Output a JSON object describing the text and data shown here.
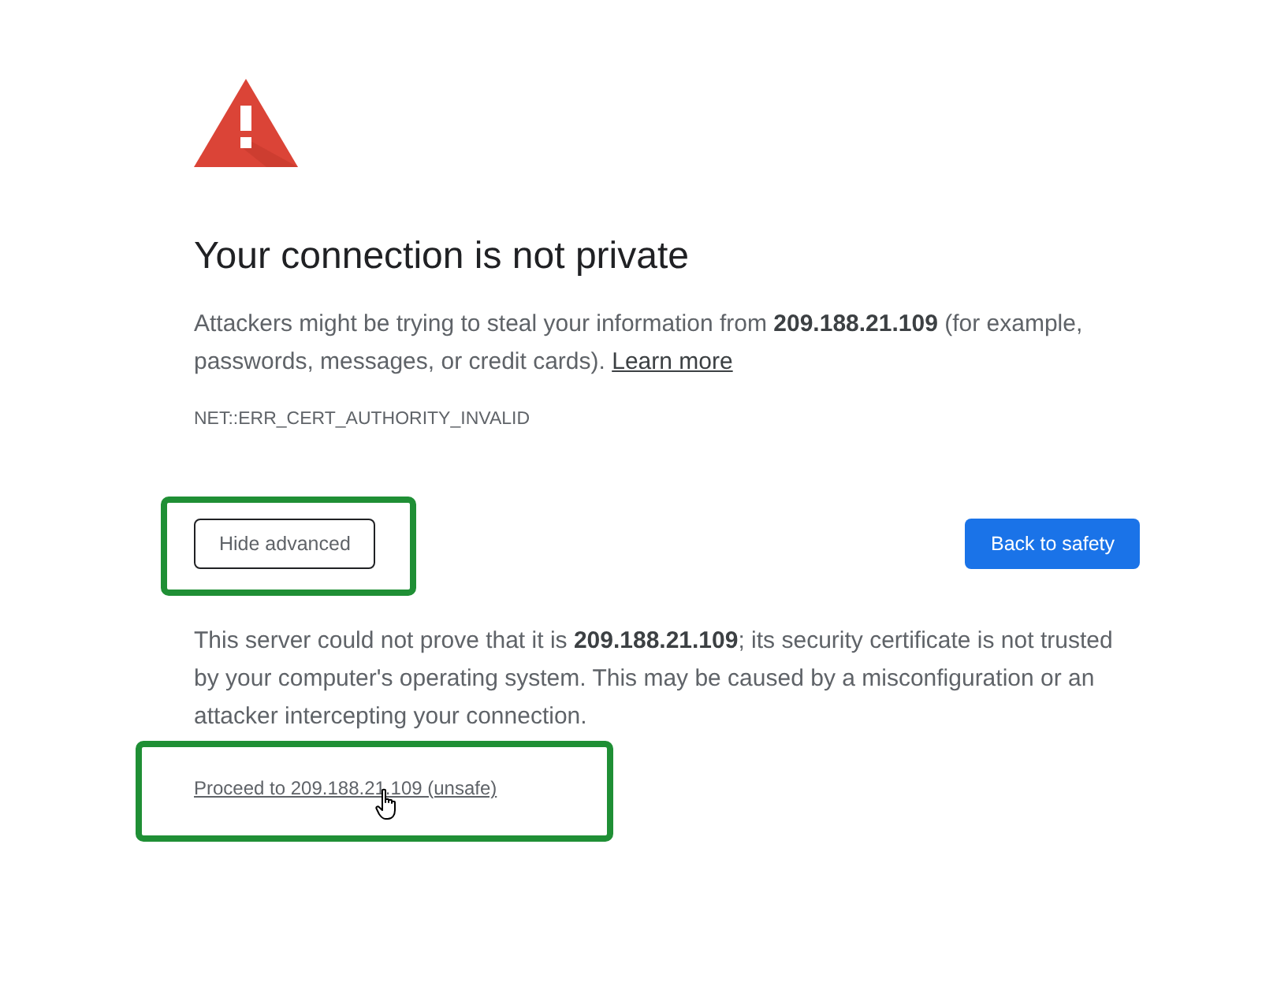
{
  "heading": "Your connection is not private",
  "main_message": {
    "text": "Attackers might be trying to steal your information from **209.188.21.109** (for example, passwords, messages, or credit cards).",
    "link": "Learn more"
  },
  "error_code": "NET::ERR_CERT_AUTHORITY_INVALID",
  "buttons": [
    {
      "label": "Hide advanced",
      "kind": "secondary",
      "highlighted": true
    },
    {
      "label": "Back to safety",
      "kind": "primary",
      "highlighted": false
    }
  ],
  "details": {
    "text": "This server could not prove that it is **209.188.21.109**; its security certificate is not trusted by your computer's operating system. This may be caused by a misconfiguration or an attacker intercepting your connection.",
    "proceed_link": {
      "label": "Proceed to 209.188.21.109 (unsafe)",
      "highlighted": true,
      "hovered": true
    }
  }
}
